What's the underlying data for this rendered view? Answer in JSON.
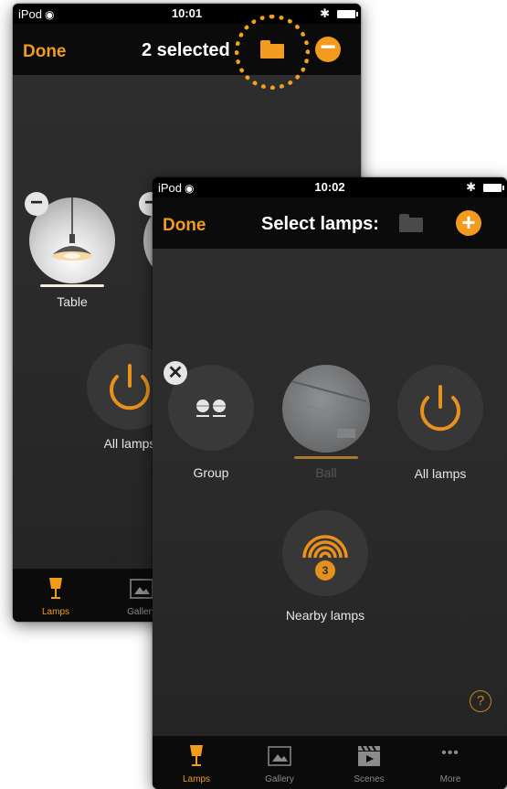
{
  "screen1": {
    "status": {
      "carrier": "iPod",
      "time": "10:01"
    },
    "nav": {
      "done": "Done",
      "title": "2 selected"
    },
    "lamps": [
      {
        "label": "Table"
      }
    ],
    "all_lamps": "All lamps",
    "tabs": [
      {
        "label": "Lamps"
      },
      {
        "label": "Gallery"
      }
    ]
  },
  "screen2": {
    "status": {
      "carrier": "iPod",
      "time": "10:02"
    },
    "nav": {
      "done": "Done",
      "title": "Select lamps:"
    },
    "group": {
      "label": "Group"
    },
    "ball": {
      "label": "Ball"
    },
    "all_lamps": "All lamps",
    "nearby": {
      "label": "Nearby lamps",
      "count": "3"
    },
    "help": "?",
    "tabs": [
      {
        "label": "Lamps"
      },
      {
        "label": "Gallery"
      },
      {
        "label": "Scenes"
      },
      {
        "label": "More"
      }
    ]
  },
  "colors": {
    "accent": "#f29b1f",
    "nav_bg": "#0b0b0b",
    "screen_bg": "#2b2b2b"
  }
}
